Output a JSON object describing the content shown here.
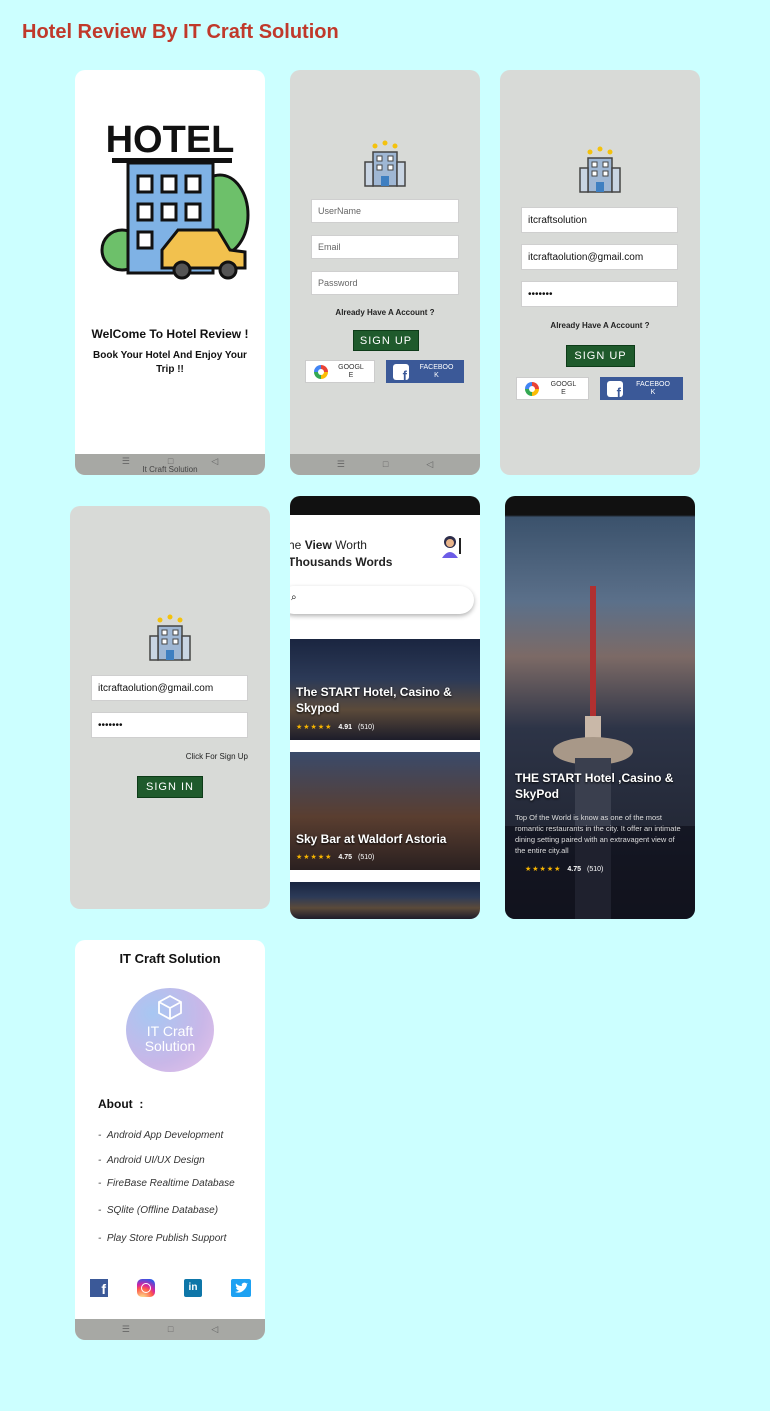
{
  "page_title": "Hotel Review By IT Craft Solution",
  "splash": {
    "logo_text": "HOTEL",
    "welcome": "WelCome To Hotel Review !",
    "tagline_line1": "Book Your Hotel And Enjoy Your",
    "tagline_line2": "Trip !!",
    "footer": "It Craft Solution"
  },
  "signup_empty": {
    "username_placeholder": "UserName",
    "email_placeholder": "Email",
    "password_placeholder": "Password",
    "already_account": "Already Have A Account ?",
    "signup_button": "SIGN UP",
    "google_label_1": "GOOGL",
    "google_label_2": "E",
    "facebook_label_1": "FACEBOO",
    "facebook_label_2": "K"
  },
  "signup_filled": {
    "username_value": "itcraftsolution",
    "email_value": "itcraftaolution@gmail.com",
    "password_value": "•••••••",
    "already_account": "Already Have A Account ?",
    "signup_button": "SIGN UP",
    "google_label_1": "GOOGL",
    "google_label_2": "E",
    "facebook_label_1": "FACEBOO",
    "facebook_label_2": "K"
  },
  "signin": {
    "email_value": "itcraftaolution@gmail.com",
    "password_value": "•••••••",
    "click_signup": "Click For Sign Up",
    "signin_button": "SIGN IN"
  },
  "home": {
    "headline_prefix": "he ",
    "headline_bold": "View",
    "headline_suffix": " Worth",
    "headline_line2": "Thousands Words",
    "cards": [
      {
        "title_line1": "The START Hotel, Casino &",
        "title_line2": "Skypod",
        "rating": "4.91",
        "count": "(510)"
      },
      {
        "title_line1": "Sky Bar at Waldorf Astoria",
        "title_line2": "",
        "rating": "4.75",
        "count": "(510)"
      }
    ]
  },
  "detail": {
    "title_line1": "THE START Hotel ,Casino &",
    "title_line2": "SkyPod",
    "description": "Top Of the World is know as one of the most romantic restaurants in the city. It offer an intimate dining setting paired with an extravagent view of the entire city.all",
    "rating": "4.75",
    "count": "(510)"
  },
  "about": {
    "title": "IT Craft Solution",
    "logo_line1": "IT Craft",
    "logo_line2": "Solution",
    "heading": "About  :",
    "items": [
      "Android App Development",
      "Android UI/UX Design",
      "FireBase Realtime Database",
      "SQlite (Offline Database)",
      "Play Store Publish Support"
    ],
    "social": [
      "f",
      "in"
    ]
  },
  "nav": {
    "menu": "☰",
    "home": "□",
    "back": "◁"
  },
  "stars": "★★★★★",
  "colors": {
    "background": "#ccffff",
    "title": "#c0392b",
    "button_green": "#1f5a2c",
    "facebook": "#3b5998"
  }
}
